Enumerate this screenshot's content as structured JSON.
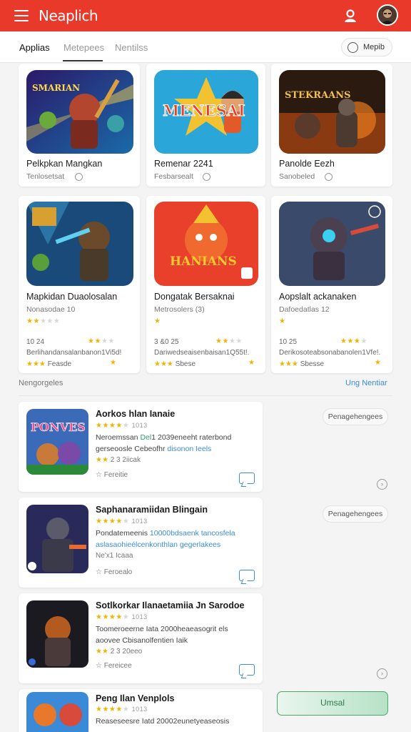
{
  "header": {
    "brand": "Neaplich",
    "colors": {
      "primary": "#e8392a",
      "link": "#3b8dd8",
      "star": "#f0b400"
    }
  },
  "tabs": [
    {
      "label": "Applias"
    },
    {
      "label": "Metepees"
    },
    {
      "label": "Nentilss"
    }
  ],
  "filter_pill": "Mepib",
  "grid": [
    {
      "art_text": "SMARIAN",
      "title": "Pelkpkan Mangkan",
      "sub": "Tenlosetsat"
    },
    {
      "art_text": "MENESAI",
      "title": "Remenar 2241",
      "sub": "Fesbarsealt"
    },
    {
      "art_text": "STEKRAANS",
      "title": "Panolde Eezh",
      "sub": "Sanobeled"
    },
    {
      "art_text": "",
      "title": "Mapkidan Duaolosalan",
      "sub": "Nonasodae 10",
      "meta1": "10 24",
      "meta2": "Berlihandansalanbanon1Vi5d!",
      "meta3": "Feasde"
    },
    {
      "art_text": "HANIANS",
      "title": "Dongatak Bersaknai",
      "sub": "Metrosolers (3)",
      "meta1": "3 &0 25",
      "meta2": "Dariwedseaisenbaisan1Q55t!.",
      "meta3": "Sbese"
    },
    {
      "art_text": "",
      "title": "Aopslalt ackanaken",
      "sub": "Dafoedatlas 12",
      "meta1": "10 25",
      "meta2": "Derikosoteabsonabanolen1Vfe!.",
      "meta3": "Sbesse"
    }
  ],
  "section": {
    "title": "Nengorgeles",
    "link": "Ung Nentiar"
  },
  "list": [
    {
      "art_text": "PONVES",
      "title": "Aorkos hlan Ianaie",
      "rating": "1013",
      "desc1a": "Neroemssan ",
      "desc1b": "Del",
      "desc1c": "1 2039eneeht raterbond",
      "desc2a": "gerseoosle Cebeofhr ",
      "desc2b": "disonon Ieels",
      "foot1": "2 3 2iicak",
      "foot2": "Fereitie",
      "side_button": "Penagehengees"
    },
    {
      "art_text": "",
      "title": "Saphanaramiidan Blingain",
      "rating": "1013",
      "desc1a": "Pondatemeenis ",
      "desc1b": "10000bdsaenk tancosfela",
      "desc2a": "aslasaohieélcenkonthlan gegerlakees",
      "foot1": "Ne'x1 Icaaa",
      "foot2": "Feroealo",
      "side_button": "Penagehengees"
    },
    {
      "art_text": "",
      "title": "Sotlkorkar Ilanaetamiia Jn Sarodoe",
      "rating": "1013",
      "desc1a": "Toomeroeerne Iata 2000heaeasogrit els",
      "desc2a": "aoovee Cbisanolfentien Iaik",
      "foot1": "2 3 20eeo",
      "foot2": "Fereicee",
      "side_button": ""
    },
    {
      "art_text": "",
      "title": "Peng Ilan Venplols",
      "rating": "1013",
      "desc1a": "Reaseseesre Iatd 20002eunetyeaseosis",
      "desc2a": "",
      "foot1": "",
      "foot2": "",
      "side_button": ""
    }
  ],
  "install_button": "Umsal"
}
